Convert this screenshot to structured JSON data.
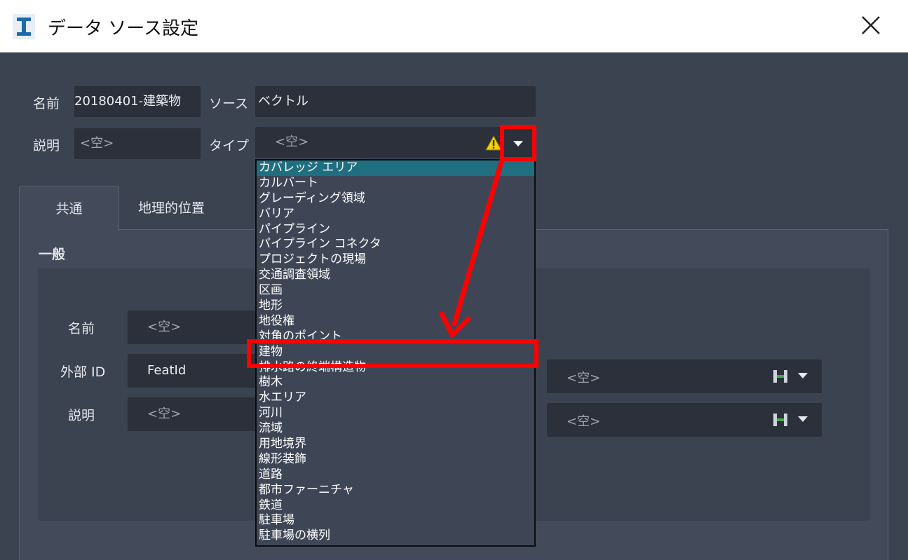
{
  "window": {
    "title": "データ ソース設定"
  },
  "header": {
    "name_label": "名前",
    "name_value": "20180401-建築物",
    "source_label": "ソース",
    "source_value": "ベクトル",
    "desc_label": "説明",
    "desc_placeholder": "<空>",
    "type_label": "タイプ",
    "type_placeholder": "<空>"
  },
  "tabs": [
    {
      "label": "共通",
      "active": true
    },
    {
      "label": "地理的位置",
      "active": false
    }
  ],
  "general": {
    "section_title": "一般",
    "name_label": "名前",
    "name_placeholder": "<空>",
    "external_id_label": "外部 ID",
    "external_id_value": "FeatId",
    "external_id_right_placeholder": "<空>",
    "desc_label": "説明",
    "desc_placeholder": "<空>",
    "desc_right_placeholder": "<空>"
  },
  "dropdown": {
    "items": [
      "カバレッジ エリア",
      "カルバート",
      "グレーディング領域",
      "バリア",
      "パイプライン",
      "パイプライン コネクタ",
      "プロジェクトの現場",
      "交通調査領域",
      "区画",
      "地形",
      "地役権",
      "対角のポイント",
      "建物",
      "排水路の終端構造物",
      "樹木",
      "水エリア",
      "河川",
      "流域",
      "用地境界",
      "線形装飾",
      "道路",
      "都市ファーニチャ",
      "鉄道",
      "駐車場",
      "駐車場の横列"
    ],
    "selected_index": 0,
    "highlighted_label": "建物"
  },
  "colors": {
    "background": "#3b4250",
    "field": "#2b303a",
    "selection": "#1f6f80",
    "annotation": "#ff0000",
    "warning": "#f5d000"
  },
  "icons": {
    "app": "app-logo-icon",
    "close": "close-icon",
    "warning": "warning-icon",
    "link": "link-icon",
    "caret": "chevron-down-icon"
  }
}
